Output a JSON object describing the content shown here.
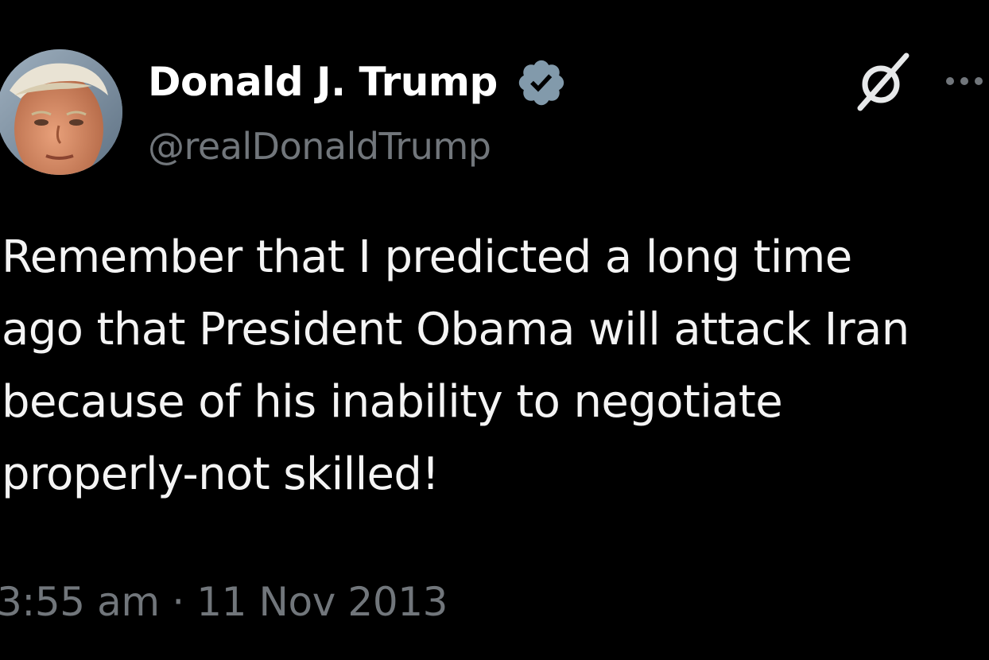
{
  "author": {
    "display_name": "Donald J. Trump",
    "handle": "@realDonaldTrump",
    "verified": true,
    "verified_badge_color": "#829aab",
    "avatar_icon": "profile-photo"
  },
  "actions": {
    "grok_icon": "grok-icon",
    "more_icon": "more-horizontal-icon"
  },
  "tweet": {
    "lines": [
      "Remember that I predicted a long time",
      "ago that President Obama will attack Iran",
      "because of his inability to negotiate",
      "properly-not skilled!"
    ]
  },
  "meta": {
    "time": "3:55 am",
    "separator": "·",
    "date": "11 Nov 2013"
  },
  "colors": {
    "background": "#000000",
    "text_primary": "#ffffff",
    "text_secondary": "#71767b"
  }
}
